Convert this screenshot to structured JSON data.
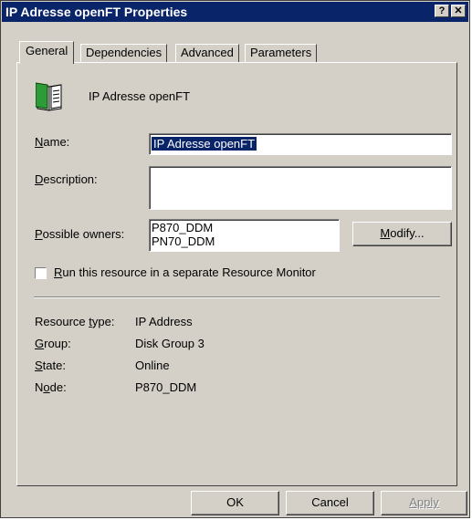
{
  "window": {
    "title": "IP Adresse openFT Properties",
    "help_button": "?",
    "close_button": "✕"
  },
  "tabs": [
    {
      "label": "General",
      "active": true
    },
    {
      "label": "Dependencies",
      "active": false
    },
    {
      "label": "Advanced",
      "active": false
    },
    {
      "label": "Parameters",
      "active": false
    }
  ],
  "general": {
    "resource_icon": "book-icon",
    "resource_name_heading": "IP Adresse openFT",
    "name_label": {
      "accel": "N",
      "rest": "ame:"
    },
    "name_value": "IP Adresse openFT",
    "description_label": {
      "accel": "D",
      "rest": "escription:"
    },
    "description_value": "",
    "possible_owners_label": {
      "accel": "P",
      "rest": "ossible owners:"
    },
    "possible_owners": [
      "P870_DDM",
      "PN70_DDM"
    ],
    "modify_button": {
      "accel": "M",
      "rest": "odify..."
    },
    "separate_monitor_checkbox": {
      "accel": "R",
      "rest": "un this resource in a separate Resource Monitor",
      "checked": false
    },
    "info": [
      {
        "label_pre": "Resource ",
        "accel": "t",
        "label_post": "ype:",
        "value": "IP Address"
      },
      {
        "label_pre": "",
        "accel": "G",
        "label_post": "roup:",
        "value": "Disk Group 3"
      },
      {
        "label_pre": "",
        "accel": "S",
        "label_post": "tate:",
        "value": "Online"
      },
      {
        "label_pre": "N",
        "accel": "o",
        "label_post": "de:",
        "value": "P870_DDM"
      }
    ]
  },
  "buttons": {
    "ok": "OK",
    "cancel": "Cancel",
    "apply": "Apply"
  },
  "colors": {
    "titlebar": "#0a246a",
    "face": "#d4d0c8",
    "selection": "#0a246a",
    "disabled_text": "#808080"
  }
}
